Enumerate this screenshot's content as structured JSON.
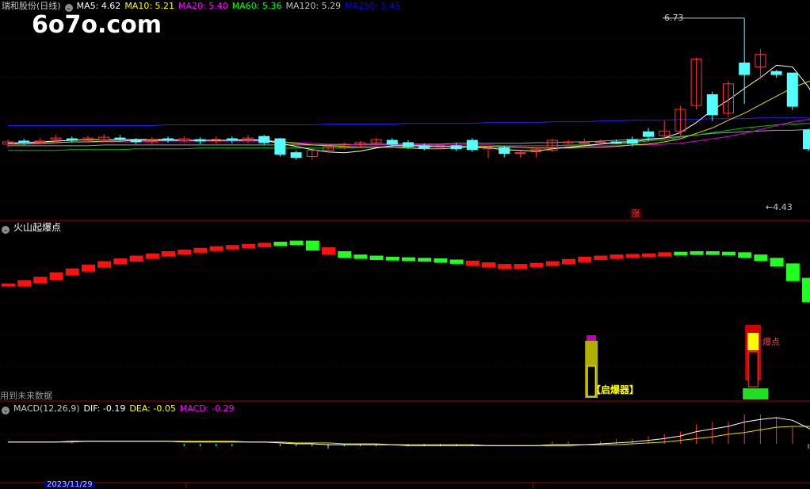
{
  "watermark": "6o7o.com",
  "main_panel": {
    "stock_name": "瑞和股份(日线)",
    "ma": [
      {
        "label": "MA5: 4.62",
        "color": "#ffffff"
      },
      {
        "label": "MA10: 5.21",
        "color": "#ffff00"
      },
      {
        "label": "MA20: 5.40",
        "color": "#ff00ff"
      },
      {
        "label": "MA60: 5.36",
        "color": "#00ff00"
      },
      {
        "label": "MA120: 5.29",
        "color": "#c0c0c0"
      },
      {
        "label": "MA250: 5.45",
        "color": "#0000ff"
      }
    ],
    "high_label": "6.73",
    "low_label": "←4.43",
    "zhang_badge": "涨"
  },
  "volcano_panel": {
    "title": "火山起爆点",
    "future_note": "用到未来数据",
    "qibao_label": "【启爆器】",
    "baodian_label": "爆点"
  },
  "macd_panel": {
    "title": "MACD(12,26,9)",
    "dif": "DIF: -0.19",
    "dea": "DEA: -0.05",
    "macd": "MACD: -0.29"
  },
  "axis_bar": {
    "date_label": "2023/11/29"
  },
  "chart_data": {
    "type": "candlestick",
    "price_range": [
      4.3,
      6.8
    ],
    "candles": [
      [
        5.1,
        5.13,
        5.06,
        5.16
      ],
      [
        5.14,
        5.12,
        5.09,
        5.17
      ],
      [
        5.13,
        5.14,
        5.1,
        5.18
      ],
      [
        5.16,
        5.18,
        5.13,
        5.22
      ],
      [
        5.17,
        5.15,
        5.12,
        5.2
      ],
      [
        5.15,
        5.18,
        5.12,
        5.21
      ],
      [
        5.16,
        5.19,
        5.13,
        5.23
      ],
      [
        5.18,
        5.16,
        5.14,
        5.22
      ],
      [
        5.15,
        5.13,
        5.1,
        5.18
      ],
      [
        5.13,
        5.16,
        5.1,
        5.19
      ],
      [
        5.17,
        5.15,
        5.12,
        5.2
      ],
      [
        5.15,
        5.17,
        5.12,
        5.2
      ],
      [
        5.16,
        5.14,
        5.1,
        5.19
      ],
      [
        5.14,
        5.16,
        5.11,
        5.2
      ],
      [
        5.17,
        5.15,
        5.11,
        5.2
      ],
      [
        5.15,
        5.18,
        5.12,
        5.22
      ],
      [
        5.2,
        5.12,
        5.09,
        5.22
      ],
      [
        5.17,
        4.97,
        4.94,
        5.18
      ],
      [
        4.99,
        4.93,
        4.9,
        5.02
      ],
      [
        4.94,
        5.02,
        4.9,
        5.05
      ],
      [
        5.02,
        5.07,
        4.99,
        5.1
      ],
      [
        5.06,
        5.1,
        5.03,
        5.12
      ],
      [
        5.1,
        5.12,
        5.05,
        5.14
      ],
      [
        5.12,
        5.16,
        5.09,
        5.18
      ],
      [
        5.15,
        5.1,
        5.06,
        5.18
      ],
      [
        5.12,
        5.07,
        5.04,
        5.15
      ],
      [
        5.08,
        5.05,
        5.02,
        5.11
      ],
      [
        5.06,
        5.08,
        5.03,
        5.1
      ],
      [
        5.08,
        5.04,
        5.01,
        5.12
      ],
      [
        5.15,
        5.03,
        5.0,
        5.18
      ],
      [
        5.04,
        5.06,
        4.92,
        5.08
      ],
      [
        5.05,
        4.98,
        4.93,
        5.08
      ],
      [
        4.98,
        4.99,
        4.93,
        5.02
      ],
      [
        5.0,
        5.03,
        4.93,
        5.06
      ],
      [
        5.02,
        5.15,
        5.0,
        5.17
      ],
      [
        5.12,
        5.13,
        5.1,
        5.16
      ],
      [
        5.11,
        5.12,
        5.09,
        5.17
      ],
      [
        5.12,
        5.13,
        5.1,
        5.16
      ],
      [
        5.13,
        5.11,
        5.1,
        5.16
      ],
      [
        5.16,
        5.11,
        5.07,
        5.2
      ],
      [
        5.26,
        5.2,
        5.14,
        5.31
      ],
      [
        5.21,
        5.27,
        5.15,
        5.4
      ],
      [
        5.27,
        5.55,
        5.21,
        5.6
      ],
      [
        5.6,
        6.2,
        5.55,
        6.22
      ],
      [
        5.74,
        5.48,
        5.4,
        5.78
      ],
      [
        5.5,
        5.88,
        5.45,
        5.92
      ],
      [
        6.15,
        6.0,
        5.62,
        6.73
      ],
      [
        6.1,
        6.26,
        5.94,
        6.33
      ],
      [
        6.04,
        6.0,
        5.96,
        6.06
      ],
      [
        6.02,
        5.59,
        5.54,
        6.02
      ],
      [
        5.28,
        5.04,
        5.01,
        5.3
      ],
      [
        4.97,
        4.66,
        4.61,
        4.99
      ],
      [
        4.61,
        4.5,
        4.44,
        4.68
      ],
      [
        4.46,
        4.5,
        4.43,
        4.5
      ],
      [
        4.5,
        4.55,
        4.44,
        4.57
      ],
      [
        4.55,
        4.62,
        4.53,
        4.64
      ]
    ],
    "ma5": [
      5.11,
      5.12,
      5.13,
      5.14,
      5.15,
      5.16,
      5.16,
      5.16,
      5.16,
      5.16,
      5.16,
      5.15,
      5.15,
      5.15,
      5.15,
      5.16,
      5.15,
      5.11,
      5.07,
      5.03,
      5.0,
      4.99,
      5.01,
      5.05,
      5.08,
      5.08,
      5.08,
      5.07,
      5.07,
      5.06,
      5.05,
      5.03,
      5.02,
      5.01,
      5.04,
      5.06,
      5.08,
      5.1,
      5.13,
      5.13,
      5.16,
      5.18,
      5.25,
      5.38,
      5.54,
      5.67,
      5.82,
      5.96,
      6.12,
      6.1,
      5.84,
      5.5,
      5.13,
      4.82,
      4.65,
      4.62
    ],
    "ma10": [
      5.1,
      5.1,
      5.11,
      5.12,
      5.13,
      5.13,
      5.14,
      5.14,
      5.15,
      5.15,
      5.15,
      5.15,
      5.15,
      5.15,
      5.15,
      5.15,
      5.15,
      5.13,
      5.11,
      5.09,
      5.08,
      5.07,
      5.06,
      5.06,
      5.06,
      5.05,
      5.04,
      5.04,
      5.05,
      5.07,
      5.07,
      5.06,
      5.06,
      5.05,
      5.05,
      5.05,
      5.06,
      5.06,
      5.07,
      5.09,
      5.1,
      5.13,
      5.17,
      5.24,
      5.31,
      5.41,
      5.5,
      5.61,
      5.72,
      5.83,
      5.91,
      5.96,
      5.89,
      5.83,
      5.74,
      5.21
    ],
    "ma20": [
      5.12,
      5.12,
      5.12,
      5.12,
      5.13,
      5.13,
      5.13,
      5.13,
      5.13,
      5.14,
      5.14,
      5.14,
      5.14,
      5.14,
      5.14,
      5.14,
      5.14,
      5.13,
      5.12,
      5.11,
      5.1,
      5.1,
      5.09,
      5.09,
      5.09,
      5.09,
      5.09,
      5.09,
      5.09,
      5.09,
      5.09,
      5.08,
      5.08,
      5.08,
      5.08,
      5.08,
      5.08,
      5.08,
      5.08,
      5.09,
      5.09,
      5.1,
      5.11,
      5.14,
      5.17,
      5.2,
      5.24,
      5.29,
      5.34,
      5.39,
      5.42,
      5.44,
      5.44,
      5.43,
      5.42,
      5.4
    ],
    "ma60": [
      5.02,
      5.02,
      5.02,
      5.02,
      5.03,
      5.03,
      5.03,
      5.03,
      5.04,
      5.04,
      5.04,
      5.04,
      5.05,
      5.05,
      5.05,
      5.05,
      5.05,
      5.05,
      5.05,
      5.05,
      5.05,
      5.05,
      5.06,
      5.06,
      5.06,
      5.06,
      5.06,
      5.07,
      5.07,
      5.07,
      5.07,
      5.07,
      5.08,
      5.08,
      5.08,
      5.09,
      5.09,
      5.1,
      5.11,
      5.12,
      5.14,
      5.16,
      5.19,
      5.22,
      5.25,
      5.28,
      5.31,
      5.33,
      5.35,
      5.36,
      5.37,
      5.37,
      5.37,
      5.36,
      5.36,
      5.36
    ],
    "ma120": [
      5.08,
      5.08,
      5.08,
      5.08,
      5.08,
      5.08,
      5.09,
      5.09,
      5.09,
      5.09,
      5.09,
      5.09,
      5.09,
      5.09,
      5.09,
      5.09,
      5.09,
      5.09,
      5.09,
      5.09,
      5.09,
      5.09,
      5.1,
      5.1,
      5.1,
      5.1,
      5.1,
      5.1,
      5.11,
      5.11,
      5.11,
      5.11,
      5.11,
      5.12,
      5.12,
      5.13,
      5.13,
      5.14,
      5.15,
      5.16,
      5.17,
      5.18,
      5.2,
      5.22,
      5.24,
      5.25,
      5.26,
      5.27,
      5.28,
      5.28,
      5.29,
      5.29,
      5.29,
      5.29,
      5.29,
      5.29
    ],
    "ma250": [
      5.34,
      5.34,
      5.34,
      5.34,
      5.34,
      5.34,
      5.34,
      5.34,
      5.34,
      5.34,
      5.35,
      5.35,
      5.35,
      5.35,
      5.35,
      5.35,
      5.35,
      5.35,
      5.35,
      5.35,
      5.36,
      5.36,
      5.36,
      5.36,
      5.36,
      5.37,
      5.37,
      5.37,
      5.37,
      5.37,
      5.38,
      5.38,
      5.38,
      5.38,
      5.39,
      5.39,
      5.39,
      5.4,
      5.4,
      5.41,
      5.41,
      5.41,
      5.42,
      5.42,
      5.43,
      5.43,
      5.43,
      5.44,
      5.44,
      5.44,
      5.44,
      5.45,
      5.45,
      5.45,
      5.45,
      5.45
    ],
    "volcano_line": [
      -0.7,
      -0.64,
      -0.58,
      -0.5,
      -0.43,
      -0.36,
      -0.3,
      -0.25,
      -0.2,
      -0.16,
      -0.12,
      -0.09,
      -0.06,
      -0.03,
      -0.01,
      0.01,
      0.03,
      0.05,
      0.07,
      -0.05,
      -0.12,
      -0.18,
      -0.2,
      -0.22,
      -0.23,
      -0.24,
      -0.25,
      -0.27,
      -0.29,
      -0.32,
      -0.35,
      -0.38,
      -0.35,
      -0.33,
      -0.3,
      -0.26,
      -0.22,
      -0.2,
      -0.18,
      -0.17,
      -0.16,
      -0.14,
      -0.13,
      -0.12,
      -0.13,
      -0.14,
      -0.18,
      -0.24,
      -0.34,
      -0.6,
      -0.98,
      -1.45,
      -1.72,
      -2.0,
      -2.3,
      -2.5
    ],
    "volcano_colors": [
      "r",
      "r",
      "r",
      "r",
      "r",
      "r",
      "r",
      "r",
      "r",
      "r",
      "r",
      "r",
      "r",
      "r",
      "r",
      "r",
      "r",
      "g",
      "g",
      "g",
      "r",
      "g",
      "g",
      "g",
      "g",
      "g",
      "g",
      "g",
      "g",
      "r",
      "r",
      "r",
      "r",
      "r",
      "r",
      "r",
      "r",
      "r",
      "r",
      "r",
      "r",
      "r",
      "g",
      "g",
      "g",
      "g",
      "g",
      "g",
      "g",
      "g",
      "g",
      "g",
      "g",
      "g",
      "g",
      "g"
    ],
    "macd_dif": [
      0.02,
      0.02,
      0.02,
      0.02,
      0.03,
      0.03,
      0.03,
      0.03,
      0.03,
      0.03,
      0.03,
      0.02,
      0.02,
      0.02,
      0.02,
      0.02,
      0.02,
      0.01,
      0.0,
      0.0,
      -0.01,
      -0.01,
      -0.01,
      -0.01,
      -0.01,
      -0.02,
      -0.02,
      -0.02,
      -0.02,
      -0.02,
      -0.02,
      -0.02,
      -0.02,
      -0.02,
      -0.01,
      -0.01,
      -0.01,
      0.0,
      0.01,
      0.02,
      0.04,
      0.06,
      0.09,
      0.14,
      0.17,
      0.2,
      0.25,
      0.28,
      0.3,
      0.27,
      0.18,
      0.07,
      -0.02,
      -0.09,
      -0.15,
      -0.19
    ],
    "macd_dea": [
      0.02,
      0.02,
      0.02,
      0.02,
      0.02,
      0.03,
      0.03,
      0.03,
      0.03,
      0.03,
      0.03,
      0.03,
      0.03,
      0.03,
      0.03,
      0.02,
      0.02,
      0.02,
      0.01,
      0.01,
      0.01,
      0.0,
      0.0,
      0.0,
      -0.01,
      -0.01,
      -0.01,
      -0.01,
      -0.01,
      -0.01,
      -0.02,
      -0.02,
      -0.02,
      -0.02,
      -0.02,
      -0.02,
      -0.01,
      -0.01,
      -0.01,
      0.0,
      0.01,
      0.02,
      0.04,
      0.06,
      0.08,
      0.11,
      0.13,
      0.16,
      0.19,
      0.2,
      0.2,
      0.18,
      0.14,
      0.08,
      0.01,
      -0.05
    ]
  }
}
